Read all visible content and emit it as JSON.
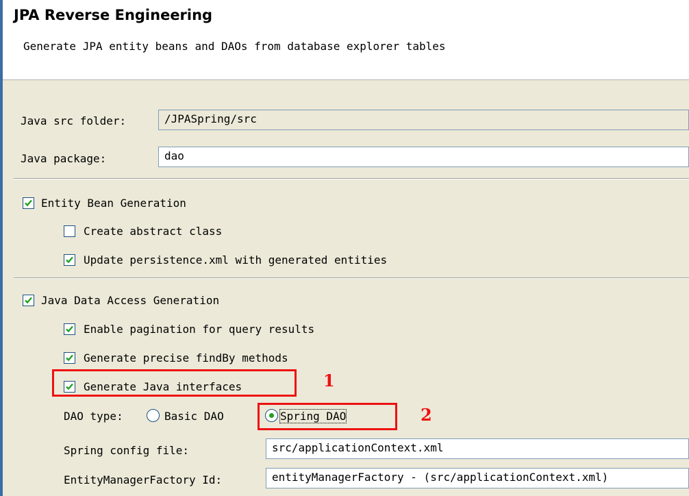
{
  "header": {
    "title": "JPA Reverse Engineering",
    "subtitle": "Generate JPA entity beans and DAOs from database explorer tables"
  },
  "form": {
    "src_folder_label": "Java src folder:",
    "src_folder_value": "/JPASpring/src",
    "package_label": "Java package:",
    "package_value": "dao"
  },
  "entity": {
    "group_label": "Entity Bean Generation",
    "group_checked": true,
    "abstract_label": "Create abstract class",
    "abstract_checked": false,
    "persistence_label": "Update persistence.xml with generated entities",
    "persistence_checked": true
  },
  "dao": {
    "group_label": "Java Data Access Generation",
    "group_checked": true,
    "pagination_label": "Enable pagination for query results",
    "pagination_checked": true,
    "findby_label": "Generate precise findBy methods",
    "findby_checked": true,
    "interfaces_label": "Generate Java interfaces",
    "interfaces_checked": true,
    "type_label": "DAO type:",
    "basic_label": "Basic DAO",
    "spring_label": "Spring DAO",
    "selected_type": "Spring DAO",
    "spring_config_label": "Spring config file:",
    "spring_config_value": "src/applicationContext.xml",
    "emf_label": "EntityManagerFactory Id:",
    "emf_value": "entityManagerFactory - (src/applicationContext.xml)"
  },
  "annotations": {
    "marker1": "1",
    "marker2": "2",
    "color": "#ee1111"
  },
  "colors": {
    "check": "#21a121",
    "accent": "#3a6ea5"
  }
}
